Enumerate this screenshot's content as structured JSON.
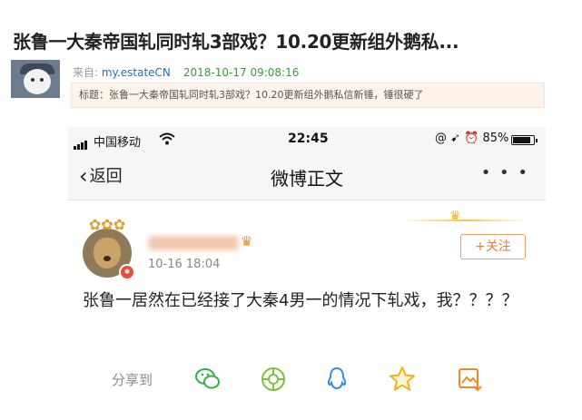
{
  "post": {
    "title": "张鲁一大秦帝国轧同时轧3部戏？10.20更新组外鹅私...",
    "source_label": "来自: ",
    "source_site": "my.estateCN",
    "datetime": "2018-10-17 09:08:16",
    "notice": "标题：张鲁一大秦帝国轧同时轧3部戏？10.20更新组外鹅私信新锤，锤很硬了"
  },
  "phone": {
    "carrier": "中国移动",
    "time": "22:45",
    "status_icons": "@ ➹ ⏰",
    "battery": "85%",
    "battery_level": 0.85
  },
  "nav": {
    "back_label": "返回",
    "title": "微博正文",
    "more": "• • •"
  },
  "weibo": {
    "post_time": "10-16 18:04",
    "follow_label": "+关注",
    "content": "张鲁一居然在已经接了大秦4男一的情况下轧戏，我？？？？",
    "share_label": "分享到"
  },
  "colors": {
    "accent": "#ef7b2a",
    "wechat": "#2bb34a",
    "moments": "#7cc242",
    "qq": "#2f8fe0",
    "favorite": "#f3b21b",
    "album": "#f08a24"
  }
}
